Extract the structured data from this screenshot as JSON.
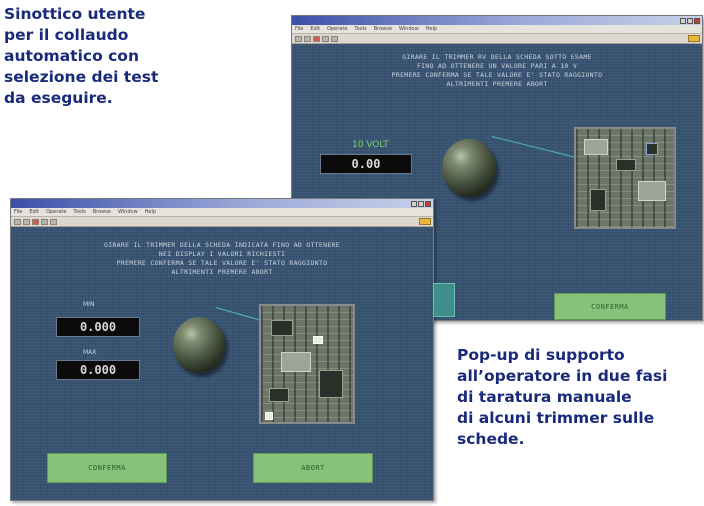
{
  "captions": {
    "top_left": "Sinottico utente\nper il collaudo\nautomatico con\nselezione dei test\nda eseguire.",
    "bottom_right": "Pop-up di supporto\nall’operatore in due fasi\ndi taratura manuale\ndi alcuni trimmer sulle\nschede."
  },
  "windows": {
    "back": {
      "menu": [
        "File",
        "Edit",
        "Operate",
        "Tools",
        "Browse",
        "Window",
        "Help"
      ],
      "instructions": [
        "GIRARE IL TRIMMER RV DELLA SCHEDA SOTTO ESAME",
        "FINO AD OTTENERE UN VALORE PARI A 10 V",
        "PREMERE CONFERMA SE TALE VALORE E' STATO RAGGIUNTO",
        "ALTRIMENTI PREMERE ABORT"
      ],
      "readout_label": "10 VOLT",
      "readout_value": "0.00",
      "button_label": "CONFERMA"
    },
    "front": {
      "menu": [
        "File",
        "Edit",
        "Operate",
        "Tools",
        "Browse",
        "Window",
        "Help"
      ],
      "instructions": [
        "GIRARE IL TRIMMER DELLA SCHEDA INDICATA FINO AD OTTENERE",
        "NEI DISPLAY I VALORI RICHIESTI",
        "PREMERE CONFERMA SE TALE VALORE E' STATO RAGGIUNTO",
        "ALTRIMENTI PREMERE ABORT"
      ],
      "display1_label": "MIN",
      "display1_value": "0.000",
      "display2_label": "MAX",
      "display2_value": "0.000",
      "button_left": "CONFERMA",
      "button_right": "ABORT"
    }
  },
  "colors": {
    "caption": "#1a2a7a",
    "panel": "#35506e",
    "button_green": "#86c27a",
    "label_green": "#7fcf6a"
  }
}
